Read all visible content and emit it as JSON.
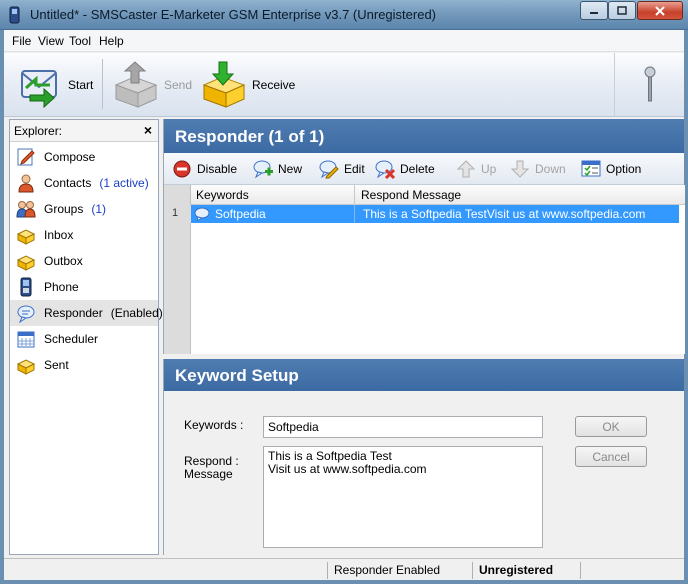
{
  "window": {
    "title": "Untitled* - SMSCaster E-Marketer GSM Enterprise v3.7 (Unregistered)"
  },
  "menu": [
    "File",
    "View",
    "Tool",
    "Help"
  ],
  "toolbar": {
    "start": "Start",
    "send": "Send",
    "receive": "Receive"
  },
  "explorer": {
    "title": "Explorer:",
    "close": "×",
    "items": [
      {
        "label": "Compose",
        "extra": ""
      },
      {
        "label": "Contacts",
        "extra": "(1 active)"
      },
      {
        "label": "Groups",
        "extra": "(1)"
      },
      {
        "label": "Inbox",
        "extra": ""
      },
      {
        "label": "Outbox",
        "extra": ""
      },
      {
        "label": "Phone",
        "extra": ""
      },
      {
        "label": "Responder",
        "extra": "(Enabled)"
      },
      {
        "label": "Scheduler",
        "extra": ""
      },
      {
        "label": "Sent",
        "extra": ""
      }
    ]
  },
  "responder": {
    "title": "Responder (1 of 1)",
    "actions": {
      "disable": "Disable",
      "new": "New",
      "edit": "Edit",
      "delete": "Delete",
      "up": "Up",
      "down": "Down",
      "option": "Option"
    },
    "columns": [
      "Keywords",
      "Respond Message"
    ],
    "rows": [
      {
        "num": "1",
        "keyword": "Softpedia",
        "message": "This is a Softpedia TestVisit us at www.softpedia.com"
      }
    ]
  },
  "keyword_setup": {
    "title": "Keyword Setup",
    "keywords_label": "Keywords :",
    "keywords_value": "Softpedia",
    "respond_label_1": "Respond :",
    "respond_label_2": "Message",
    "message_value": "This is a Softpedia Test\nVisit us at www.softpedia.com",
    "ok": "OK",
    "cancel": "Cancel"
  },
  "status": {
    "responder": "Responder Enabled",
    "registration": "Unregistered"
  },
  "colors": {
    "header_blue": "#3c6aa3",
    "selection": "#3399ff",
    "link_blue": "#1a3ec8"
  }
}
